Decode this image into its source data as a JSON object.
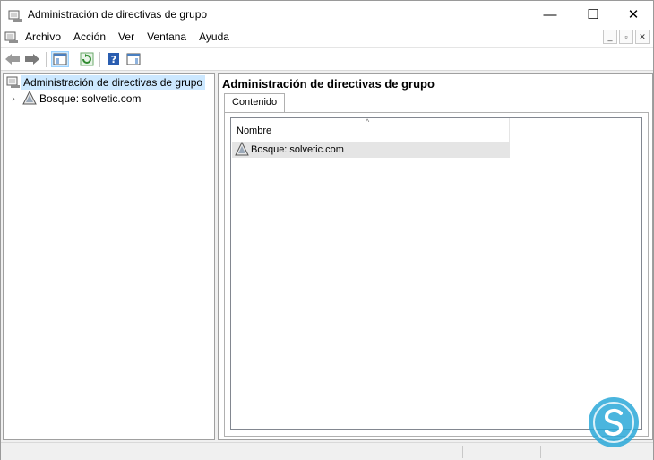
{
  "window": {
    "title": "Administración de directivas de grupo",
    "controls": {
      "minimize": "—",
      "maximize": "☐",
      "close": "✕"
    }
  },
  "menubar": {
    "items": [
      "Archivo",
      "Acción",
      "Ver",
      "Ventana",
      "Ayuda"
    ],
    "mdi_controls": [
      "_",
      "▫",
      "✕"
    ]
  },
  "toolbar": {
    "buttons": [
      "back-icon",
      "forward-icon",
      "show-hide-tree-icon",
      "refresh-icon",
      "help-icon",
      "action-pane-icon"
    ]
  },
  "tree": {
    "root": {
      "label": "Administración de directivas de grupo"
    },
    "children": [
      {
        "label": "Bosque: solvetic.com",
        "expander": "›"
      }
    ]
  },
  "content": {
    "header": "Administración de directivas de grupo",
    "tab": "Contenido",
    "column": {
      "label": "Nombre",
      "sort_indicator": "^"
    },
    "rows": [
      {
        "label": "Bosque: solvetic.com"
      }
    ]
  },
  "colors": {
    "selection": "#cce8ff",
    "row_highlight": "#e5e5e5",
    "watermark": "#2aa8d8"
  }
}
